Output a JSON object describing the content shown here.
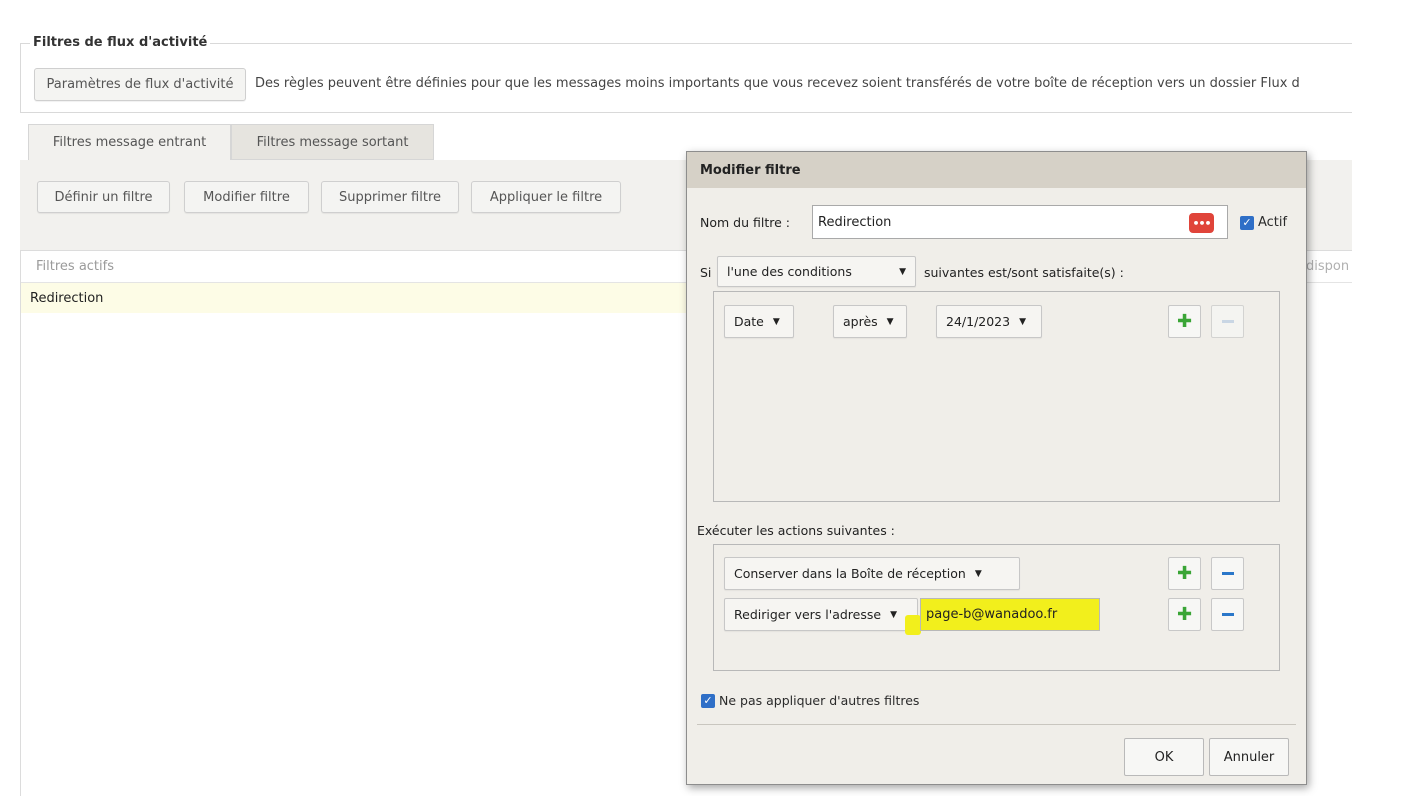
{
  "activity_stream": {
    "legend": "Filtres de flux d'activité",
    "settings_button": "Paramètres de flux d'activité",
    "description": "Des règles peuvent être définies pour que les messages moins importants que vous recevez soient transférés de votre boîte de réception vers un dossier Flux d"
  },
  "tabs": [
    {
      "label": "Filtres message entrant",
      "active": true
    },
    {
      "label": "Filtres message sortant",
      "active": false
    }
  ],
  "toolbar": {
    "define": "Définir un filtre",
    "modify": "Modifier filtre",
    "delete": "Supprimer filtre",
    "apply": "Appliquer le filtre"
  },
  "filters_list": {
    "header_left": "Filtres actifs",
    "header_right": "dispon",
    "items": [
      "Redirection"
    ]
  },
  "dialog": {
    "title": "Modifier filtre",
    "name_label": "Nom du filtre :",
    "name_value": "Redirection",
    "active_label": "Actif",
    "active_checked": true,
    "if_label": "Si",
    "match_select": "l'une des conditions",
    "match_suffix": "suivantes est/sont satisfaite(s) :",
    "conditions": [
      {
        "field": "Date",
        "operator": "après",
        "value": "24/1/2023"
      }
    ],
    "actions_label": "Exécuter les actions suivantes :",
    "actions": [
      {
        "action": "Conserver dans la Boîte de réception",
        "value": ""
      },
      {
        "action": "Rediriger vers l'adresse",
        "value": "page-b@wanadoo.fr"
      }
    ],
    "no_more_filters_label": "Ne pas appliquer d'autres filtres",
    "no_more_filters_checked": true,
    "ok": "OK",
    "cancel": "Annuler"
  },
  "colors": {
    "highlight": "#f2ef1c",
    "accent_blue": "#2f6fc7",
    "plus_green": "#3aa536",
    "password_icon_red": "#e0443a"
  },
  "icons": [
    "password-dots-icon",
    "checkmark-icon",
    "chevron-down-icon",
    "plus-icon",
    "minus-icon"
  ]
}
